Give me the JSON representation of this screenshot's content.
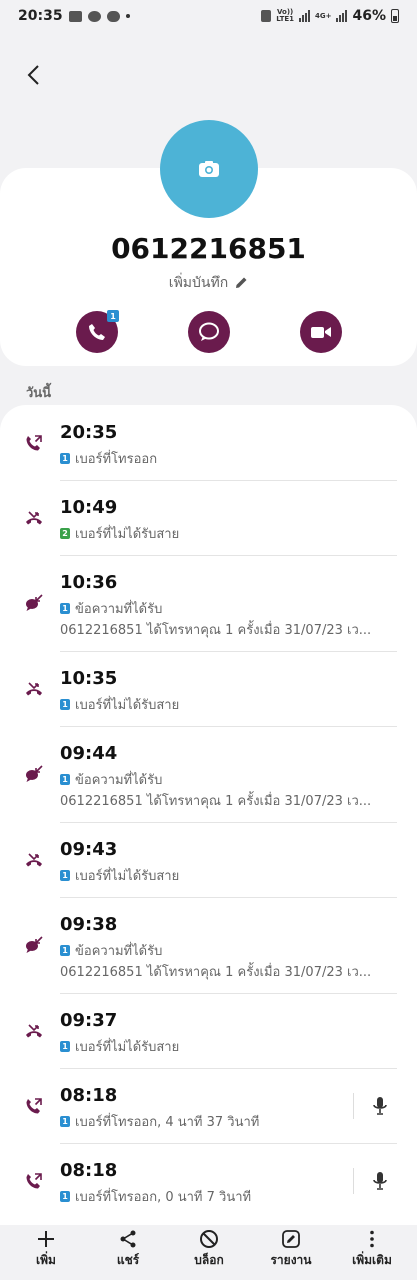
{
  "status_bar": {
    "time": "20:35",
    "net_top": "Vo))",
    "net_bottom": "LTE1",
    "net2_top": "4G+",
    "battery": "46%"
  },
  "contact": {
    "number": "0612216851",
    "add_note": "เพิ่มบันทึก",
    "call_badge": "1"
  },
  "section_label": "วันนี้",
  "log": [
    {
      "time": "20:35",
      "sim": "1",
      "desc": "เบอร์ที่โทรออก",
      "type": "outgoing"
    },
    {
      "time": "10:49",
      "sim": "2",
      "desc": "เบอร์ที่ไม่ได้รับสาย",
      "type": "missed"
    },
    {
      "time": "10:36",
      "sim": "1",
      "desc": "ข้อความที่ได้รับ",
      "extra": "0612216851 ได้โทรหาคุณ 1 ครั้งเมื่อ 31/07/23 เว...",
      "type": "message"
    },
    {
      "time": "10:35",
      "sim": "1",
      "desc": "เบอร์ที่ไม่ได้รับสาย",
      "type": "missed"
    },
    {
      "time": "09:44",
      "sim": "1",
      "desc": "ข้อความที่ได้รับ",
      "extra": "0612216851 ได้โทรหาคุณ 1 ครั้งเมื่อ 31/07/23 เว...",
      "type": "message"
    },
    {
      "time": "09:43",
      "sim": "1",
      "desc": "เบอร์ที่ไม่ได้รับสาย",
      "type": "missed"
    },
    {
      "time": "09:38",
      "sim": "1",
      "desc": "ข้อความที่ได้รับ",
      "extra": "0612216851 ได้โทรหาคุณ 1 ครั้งเมื่อ 31/07/23 เว...",
      "type": "message"
    },
    {
      "time": "09:37",
      "sim": "1",
      "desc": "เบอร์ที่ไม่ได้รับสาย",
      "type": "missed"
    },
    {
      "time": "08:18",
      "sim": "1",
      "desc": "เบอร์ที่โทรออก, 4 นาที 37 วินาที",
      "type": "outgoing",
      "recording": true
    },
    {
      "time": "08:18",
      "sim": "1",
      "desc": "เบอร์ที่โทรออก, 0 นาที 7 วินาที",
      "type": "outgoing",
      "recording": true
    }
  ],
  "bottom_nav": {
    "add": "เพิ่ม",
    "share": "แชร์",
    "block": "บล็อก",
    "report": "รายงาน",
    "more": "เพิ่มเติม"
  },
  "colors": {
    "accent": "#6a1b4d",
    "avatar": "#4db3d6",
    "sim1": "#2a8fd1",
    "sim2": "#3aa14a"
  },
  "icons": {
    "outgoing": "outgoing-call-icon",
    "missed": "missed-call-icon",
    "message": "received-message-icon",
    "recording": "microphone-icon"
  }
}
